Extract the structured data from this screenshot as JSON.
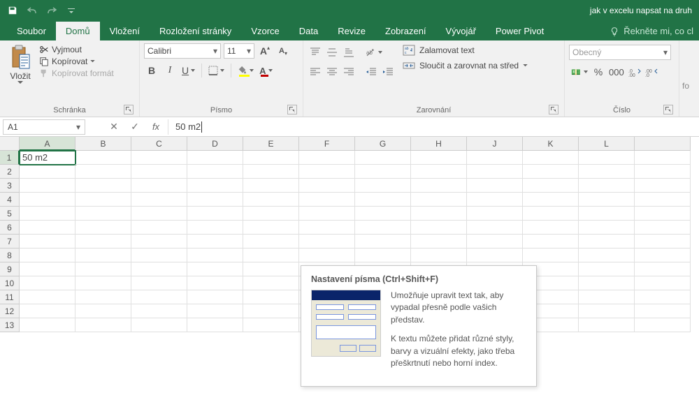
{
  "titlebar": {
    "doc_title": "jak v excelu napsat na druh"
  },
  "tabs": {
    "file": "Soubor",
    "home": "Domů",
    "insert": "Vložení",
    "layout": "Rozložení stránky",
    "formulas": "Vzorce",
    "data": "Data",
    "review": "Revize",
    "view": "Zobrazení",
    "developer": "Vývojář",
    "powerpivot": "Power Pivot",
    "tell_me": "Řekněte mi, co cl"
  },
  "ribbon": {
    "clipboard": {
      "paste": "Vložit",
      "cut": "Vyjmout",
      "copy": "Kopírovat",
      "format_painter": "Kopírovat formát",
      "group": "Schránka"
    },
    "font": {
      "name": "Calibri",
      "size": "11",
      "group": "Písmo"
    },
    "alignment": {
      "wrap": "Zalamovat text",
      "merge": "Sloučit a zarovnat na střed",
      "group": "Zarovnání"
    },
    "number": {
      "format": "Obecný",
      "group": "Číslo"
    },
    "fo": "fo"
  },
  "formula_bar": {
    "name_box": "A1",
    "formula": "50 m2"
  },
  "sheet": {
    "columns": [
      "A",
      "B",
      "C",
      "D",
      "E",
      "F",
      "G",
      "H",
      "J",
      "K",
      "L"
    ],
    "rows": [
      "1",
      "2",
      "3",
      "4",
      "5",
      "6",
      "7",
      "8",
      "9",
      "10",
      "11",
      "12",
      "13"
    ],
    "a1": "50 m2"
  },
  "tooltip": {
    "title": "Nastavení písma (Ctrl+Shift+F)",
    "p1": "Umožňuje upravit text tak, aby vypadal přesně podle vašich představ.",
    "p2": "K textu můžete přidat různé styly, barvy a vizuální efekty, jako třeba přeškrtnutí nebo horní index."
  }
}
